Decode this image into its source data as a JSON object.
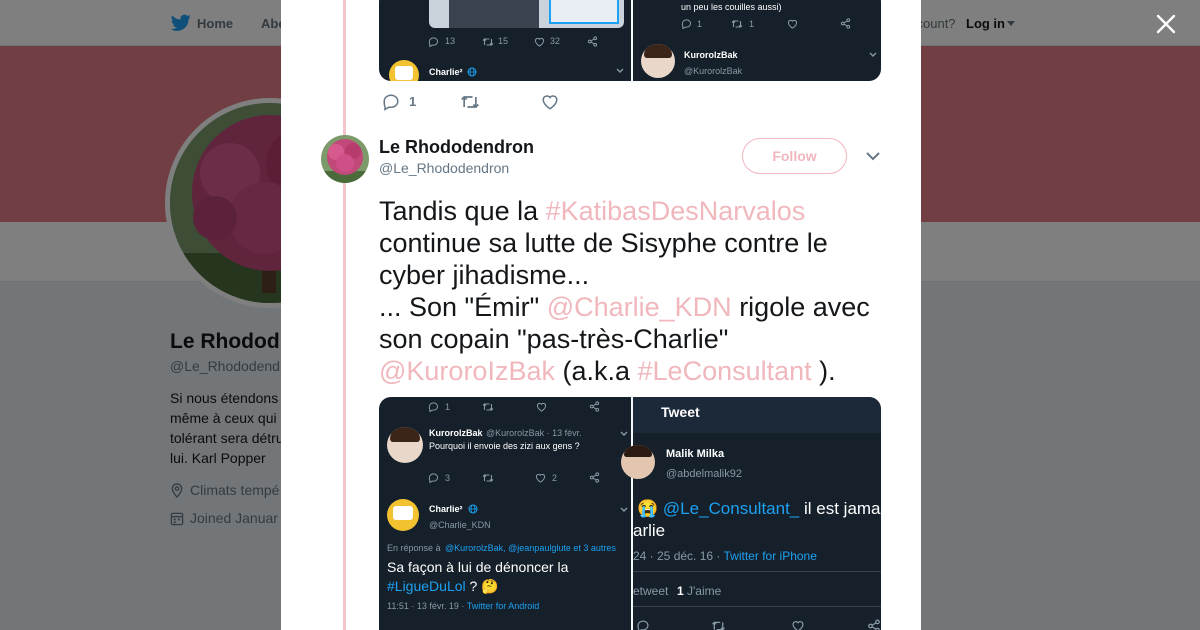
{
  "topbar": {
    "home_label": "Home",
    "about_label": "Abo",
    "account_text": "ccount?",
    "login_label": "Log in"
  },
  "profile": {
    "name": "Le Rhodod",
    "handle": "@Le_Rhododendr",
    "bio_lines": [
      "Si nous étendons",
      "même à ceux qui",
      "tolérant sera détru",
      "lui. Karl Popper"
    ],
    "location": "Climats tempé",
    "joined": "Joined Januar"
  },
  "top_card": {
    "left": {
      "text": "",
      "stats": {
        "replies": "13",
        "retweets": "15",
        "likes": "32"
      },
      "user_name": "Charlie²"
    },
    "right": {
      "text": "un peu les couilles aussi)",
      "stats": {
        "replies": "1",
        "retweets": "1"
      },
      "user_name": "KurorolzBak",
      "user_handle": "@KurorolzBak"
    }
  },
  "prev_actions": {
    "reply_count": "1"
  },
  "tweet": {
    "author_name": "Le Rhododendron",
    "author_handle": "@Le_Rhododendron",
    "follow_label": "Follow",
    "text": {
      "l1_pre": "Tandis que la ",
      "l1_tag": "#KatibasDesNarvalos",
      "l2": "continue sa lutte de Sisyphe contre le",
      "l3": "cyber jihadisme...",
      "l4_pre": "... Son \"Émir\" ",
      "l4_mention": "@Charlie_KDN",
      "l4_post": " rigole avec",
      "l5": "son copain \"pas-très-Charlie\"",
      "l6_mention": "@KuroroIzBak",
      "l6_mid": " (a.k.a ",
      "l6_tag": "#LeConsultant",
      "l6_post": " )."
    }
  },
  "media_card": {
    "left": {
      "top_stats": {
        "replies": "1"
      },
      "reply1_name": "KurorolzBak",
      "reply1_meta": "@KurorolzBak · 13 févr.",
      "reply1_text": "Pourquoi il envoie des zizi aux gens ?",
      "reply1_stats": {
        "replies": "3",
        "likes": "2"
      },
      "reply2_name": "Charlie²",
      "reply2_handle": "@Charlie_KDN",
      "in_reply_prefix": "En réponse à ",
      "in_reply_users": "@KurorolzBak, @jeanpaulglute et 3 autres",
      "main_text_l1": "Sa façon à lui de dénoncer la",
      "main_text_tag": "#LigueDuLol",
      "main_text_emoji": " ? 🤔",
      "timestamp": "11:51 · 13 févr. 19 · ",
      "client": "Twitter for Android"
    },
    "right": {
      "header": "Tweet",
      "user_name": "Malik Milka",
      "user_handle": "@abdelmalik92",
      "text_emoji": "😭",
      "text_mention": "@Le_Consultant_",
      "text_post": " il est jama",
      "text_l2": "arlie",
      "timestamp": "24 · 25 déc. 16 · ",
      "client": "Twitter for iPhone",
      "retweets_label": "etweet",
      "likes_count": "1",
      "likes_label": "J'aime"
    }
  },
  "colors": {
    "accent": "#f0b7bd",
    "banner": "#e07d86",
    "dark_card": "#15202b",
    "twitter_blue": "#1da1f2"
  }
}
